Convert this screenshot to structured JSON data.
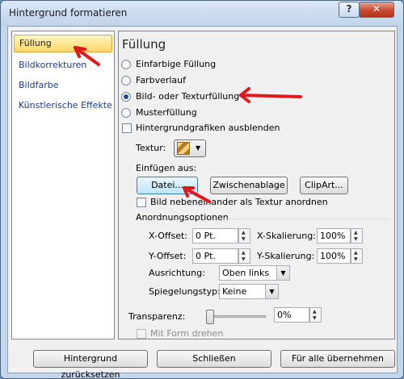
{
  "window": {
    "title": "Hintergrund formatieren",
    "help_label": "?",
    "close_label": "✕"
  },
  "sidebar": {
    "items": [
      {
        "label": "Füllung",
        "selected": true
      },
      {
        "label": "Bildkorrekturen"
      },
      {
        "label": "Bildfarbe"
      },
      {
        "label": "Künstlerische Effekte"
      }
    ]
  },
  "panel": {
    "title": "Füllung",
    "fill_options": [
      {
        "label": "Einfarbige Füllung",
        "checked": false
      },
      {
        "label": "Farbverlauf",
        "checked": false
      },
      {
        "label": "Bild- oder Texturfüllung",
        "checked": true
      },
      {
        "label": "Musterfüllung",
        "checked": false
      }
    ],
    "hide_graphics_label": "Hintergrundgrafiken ausblenden",
    "texture_label": "Textur:",
    "insert_from_label": "Einfügen aus:",
    "buttons": {
      "file": "Datei...",
      "clipboard": "Zwischenablage",
      "clipart": "ClipArt..."
    },
    "tile_label": "Bild nebeneinander als Textur anordnen",
    "layout_options_label": "Anordnungsoptionen",
    "x_offset": {
      "label": "X-Offset:",
      "value": "0 Pt."
    },
    "y_offset": {
      "label": "Y-Offset:",
      "value": "0 Pt."
    },
    "x_scale": {
      "label": "X-Skalierung:",
      "value": "100%"
    },
    "y_scale": {
      "label": "Y-Skalierung:",
      "value": "100%"
    },
    "alignment": {
      "label": "Ausrichtung:",
      "value": "Oben links"
    },
    "mirror": {
      "label": "Spiegelungstyp:",
      "value": "Keine"
    },
    "transparency": {
      "label": "Transparenz:",
      "value": "0%",
      "level": 0
    },
    "rotate_with_shape_label": "Mit Form drehen"
  },
  "footer": {
    "reset": "Hintergrund zurücksetzen",
    "close": "Schließen",
    "apply_all": "Für alle übernehmen"
  },
  "colors": {
    "annotation_red": "#e0191d"
  }
}
